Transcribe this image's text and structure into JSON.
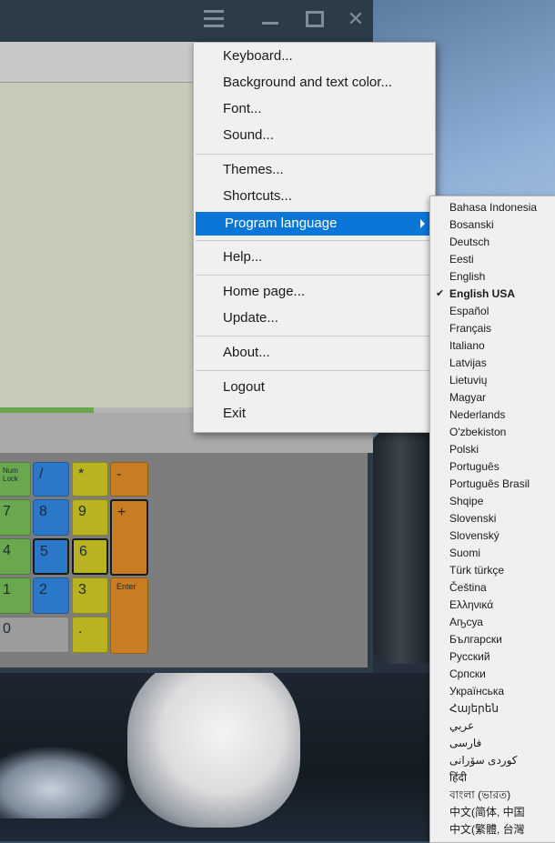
{
  "menu": {
    "groups": [
      [
        "Keyboard...",
        "Background and text color...",
        "Font...",
        "Sound..."
      ],
      [
        "Themes...",
        "Shortcuts...",
        "Program language"
      ],
      [
        "Help..."
      ],
      [
        "Home page...",
        "Update..."
      ],
      [
        "About..."
      ],
      [
        "Logout",
        "Exit"
      ]
    ],
    "active_item": "Program language"
  },
  "language_menu": {
    "selected": "English USA",
    "items": [
      "Bahasa Indonesia",
      "Bosanski",
      "Deutsch",
      "Eesti",
      "English",
      "English USA",
      "Español",
      "Français",
      "Italiano",
      "Latvijas",
      "Lietuvių",
      "Magyar",
      "Nederlands",
      "O'zbekiston",
      "Polski",
      "Português",
      "Português Brasil",
      "Shqipe",
      "Slovenski",
      "Slovenský",
      "Suomi",
      "Türk türkçe",
      "Čeština",
      "Ελληνικά",
      "Аҧсуа",
      "Български",
      "Русский",
      "Српски",
      "Українська",
      "Հայերեն",
      "عربي",
      "فارسی",
      "كوردی سۆرانی",
      "हिंदी",
      "বাংলা (ভারত)",
      "中文(简体, 中国",
      "中文(繁體, 台灣"
    ]
  },
  "keypad": {
    "num_lock": "Num Lock",
    "slash": "/",
    "asterisk": "*",
    "minus": "-",
    "seven": "7",
    "eight": "8",
    "nine": "9",
    "plus": "+",
    "four": "4",
    "five": "5",
    "six": "6",
    "one": "1",
    "two": "2",
    "three": "3",
    "enter": "Enter",
    "zero": "0",
    "dot": "."
  },
  "progress": {
    "fraction": 0.25
  },
  "colors": {
    "menu_highlight": "#0a76d8",
    "key_green": "#6aa84f",
    "key_blue": "#2b78c8",
    "key_yellow": "#b8b31f",
    "key_orange": "#c97d22"
  },
  "icons": {
    "menu": "hamburger-icon",
    "minimize": "minimize-icon",
    "maximize": "maximize-icon",
    "close": "close-icon",
    "submenu": "chevron-right-icon",
    "check": "checkmark-icon"
  }
}
